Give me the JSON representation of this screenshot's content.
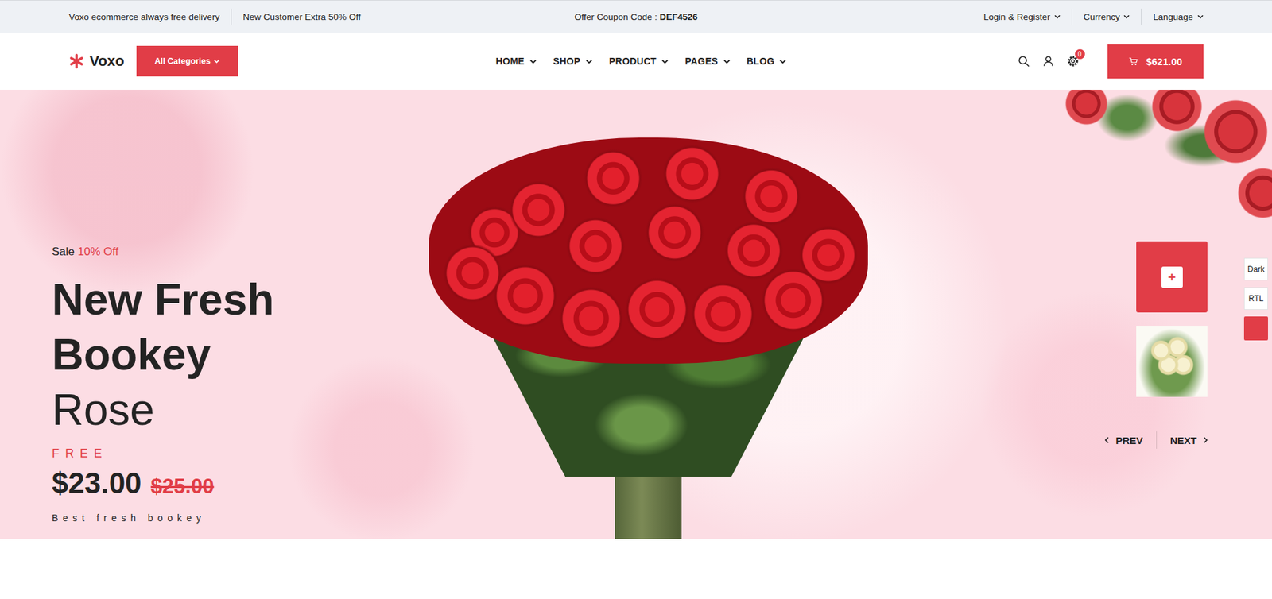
{
  "topbar": {
    "notices": [
      "Voxo ecommerce always free delivery",
      "New Customer Extra 50% Off"
    ],
    "coupon": {
      "label": "Offer Coupon Code :",
      "code": "DEF4526"
    },
    "menus": [
      "Login & Register",
      "Currency",
      "Language"
    ]
  },
  "header": {
    "logo": "Voxo",
    "categories": "All Categories",
    "nav": [
      "HOME",
      "SHOP",
      "PRODUCT",
      "PAGES",
      "BLOG"
    ],
    "settings_badge": "0",
    "cart_total": "$621.00"
  },
  "hero": {
    "sale_label": "Sale",
    "sale_value": "10% Off",
    "title_lines": [
      "New Fresh",
      "Bookey"
    ],
    "subtitle": "Rose",
    "tag": "FREE",
    "price": "$23.00",
    "old_price": "$25.00",
    "caption": "Best fresh bookey"
  },
  "slider": {
    "thumbs": [
      {
        "selected": true,
        "label": "+"
      },
      {
        "selected": false,
        "label": ""
      }
    ],
    "prev": "PREV",
    "next": "NEXT"
  },
  "side_tools": [
    {
      "kind": "text",
      "label": "Dark",
      "color": "#ffffff"
    },
    {
      "kind": "text",
      "label": "RTL",
      "color": "#ffffff"
    },
    {
      "kind": "swatch",
      "label": "",
      "color": "#e13d47"
    }
  ]
}
